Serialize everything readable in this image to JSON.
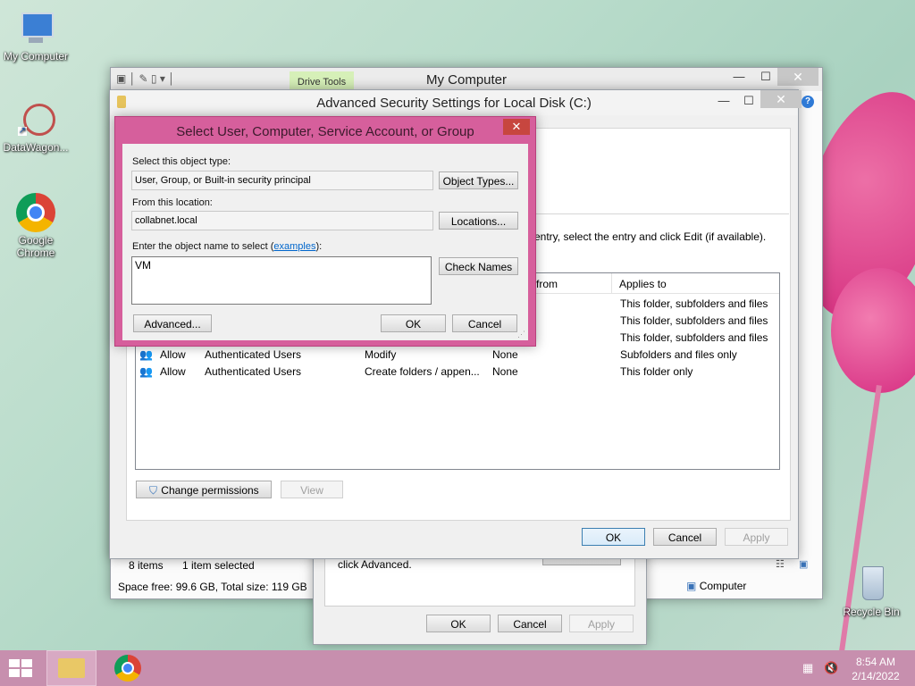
{
  "desktop": {
    "icons": [
      {
        "label": "My Computer"
      },
      {
        "label": "DataWagon..."
      },
      {
        "label": "Google Chrome"
      },
      {
        "label": "Recycle Bin"
      }
    ]
  },
  "explorer": {
    "title": "My Computer",
    "ribbon_tab": "Drive Tools",
    "status_items": "8 items",
    "status_selected": "1 item selected",
    "space_info": "Space free: 99.6 GB, Total size: 119 GB",
    "computer_label": "Computer"
  },
  "props_dialog": {
    "hint_text": "click Advanced.",
    "ok": "OK",
    "cancel": "Cancel",
    "apply": "Apply"
  },
  "advanced": {
    "title": "Advanced Security Settings for Local Disk (C:)",
    "instruction": "entry, select the entry and click Edit (if available).",
    "columns": {
      "inherited_from": "from",
      "applies_to": "Applies to"
    },
    "rows": [
      {
        "type": "",
        "principal": "",
        "access": "",
        "inherited": "",
        "applies": "This folder, subfolders and files"
      },
      {
        "type": "",
        "principal": "",
        "access": "",
        "inherited": "",
        "applies": "This folder, subfolders and files"
      },
      {
        "type": "",
        "principal": "",
        "access": "",
        "inherited": "",
        "applies": "This folder, subfolders and files"
      },
      {
        "type": "Allow",
        "principal": "Authenticated Users",
        "access": "Modify",
        "inherited": "None",
        "applies": "Subfolders and files only"
      },
      {
        "type": "Allow",
        "principal": "Authenticated Users",
        "access": "Create folders / appen...",
        "inherited": "None",
        "applies": "This folder only"
      }
    ],
    "change_permissions": "Change permissions",
    "view": "View",
    "ok": "OK",
    "cancel": "Cancel",
    "apply": "Apply"
  },
  "select_dialog": {
    "title": "Select User, Computer, Service Account, or Group",
    "object_type_label": "Select this object type:",
    "object_type_value": "User, Group, or Built-in security principal",
    "object_types_button": "Object Types...",
    "location_label": "From this location:",
    "location_value": "collabnet.local",
    "locations_button": "Locations...",
    "name_label": "Enter the object name to select (",
    "name_link": "examples",
    "name_label_end": "):",
    "name_value": "VM",
    "check_names_button": "Check Names",
    "advanced_button": "Advanced...",
    "ok": "OK",
    "cancel": "Cancel"
  },
  "taskbar": {
    "time": "8:54 AM",
    "date": "2/14/2022"
  },
  "colors": {
    "dialog_frame": "#d65f9c",
    "taskbar": "#c78fae",
    "link": "#0066cc"
  }
}
